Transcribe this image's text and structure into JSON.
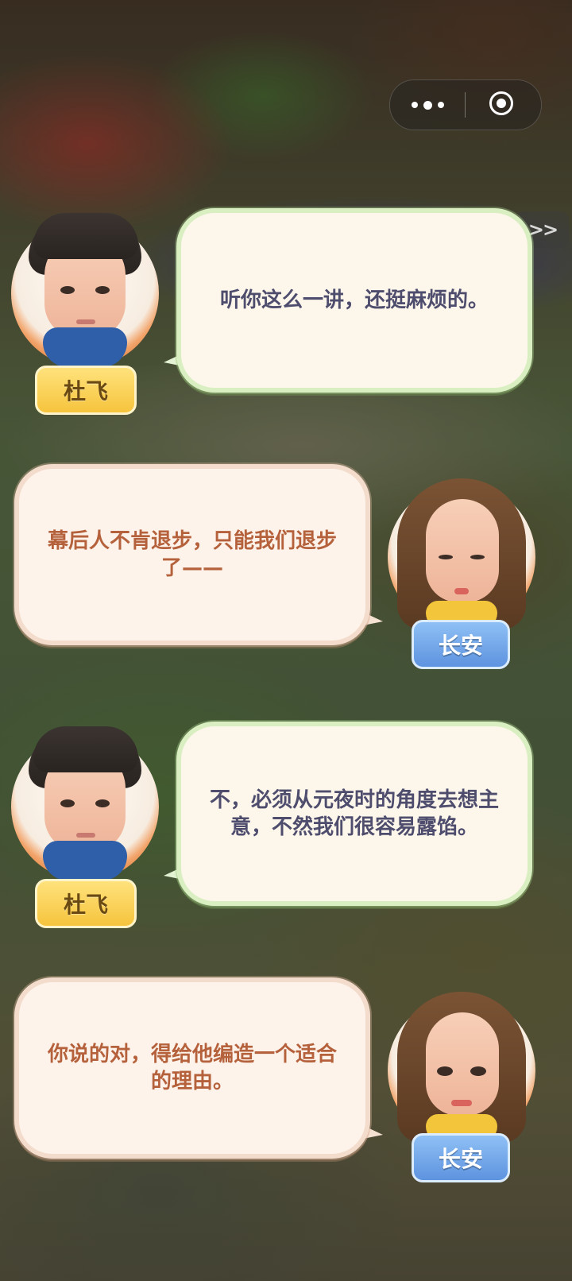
{
  "system": {
    "more_icon": "more-dots-icon",
    "close_icon": "target-circle-icon"
  },
  "skip_label": ">>",
  "dialogues": [
    {
      "speaker": "杜飞",
      "side": "left",
      "text": "听你这么一讲，还挺麻烦的。"
    },
    {
      "speaker": "长安",
      "side": "right",
      "text": "幕后人不肯退步，只能我们退步了——"
    },
    {
      "speaker": "杜飞",
      "side": "left",
      "text": "不，必须从元夜时的角度去想主意，不然我们很容易露馅。"
    },
    {
      "speaker": "长安",
      "side": "right",
      "text": "你说的对，得给他编造一个适合的理由。"
    }
  ]
}
